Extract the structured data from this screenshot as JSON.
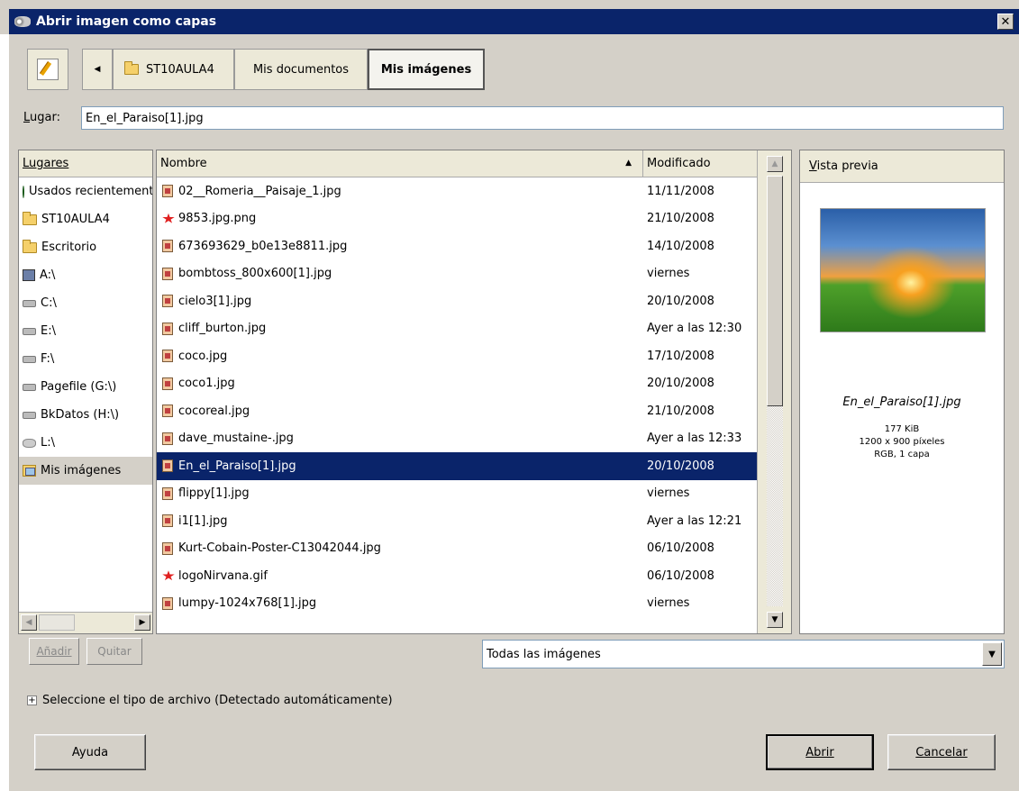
{
  "window": {
    "title": "Abrir imagen como capas",
    "close_glyph": "✕"
  },
  "pathbar": {
    "back_glyph": "◀",
    "crumbs": [
      "ST10AULA4",
      "Mis documentos",
      "Mis imágenes"
    ]
  },
  "location": {
    "label": "Lugar:",
    "value": "En_el_Paraiso[1].jpg"
  },
  "places": {
    "header": "Lugares",
    "items": [
      {
        "label": "Usados recientemente",
        "icon": "history-icon"
      },
      {
        "label": "ST10AULA4",
        "icon": "folder-icon"
      },
      {
        "label": "Escritorio",
        "icon": "folder-icon"
      },
      {
        "label": "A:\\",
        "icon": "floppy-icon"
      },
      {
        "label": "C:\\",
        "icon": "drive-icon"
      },
      {
        "label": "E:\\",
        "icon": "drive-icon"
      },
      {
        "label": "F:\\",
        "icon": "drive-icon"
      },
      {
        "label": "Pagefile (G:\\)",
        "icon": "drive-icon"
      },
      {
        "label": "BkDatos (H:\\)",
        "icon": "drive-icon"
      },
      {
        "label": "L:\\",
        "icon": "network-drive-icon"
      },
      {
        "label": "Mis imágenes",
        "icon": "pictures-folder-icon"
      }
    ]
  },
  "files": {
    "col_name": "Nombre",
    "col_modified": "Modificado",
    "sort_glyph": "▲",
    "rows": [
      {
        "name": "02__Romeria__Paisaje_1.jpg",
        "date": "11/11/2008"
      },
      {
        "name": "9853.jpg.png",
        "date": "21/10/2008"
      },
      {
        "name": "673693629_b0e13e8811.jpg",
        "date": "14/10/2008"
      },
      {
        "name": "bombtoss_800x600[1].jpg",
        "date": "viernes"
      },
      {
        "name": "cielo3[1].jpg",
        "date": "20/10/2008"
      },
      {
        "name": "cliff_burton.jpg",
        "date": "Ayer a las 12:30"
      },
      {
        "name": "coco.jpg",
        "date": "17/10/2008"
      },
      {
        "name": "coco1.jpg",
        "date": "20/10/2008"
      },
      {
        "name": "cocoreal.jpg",
        "date": "21/10/2008"
      },
      {
        "name": "dave_mustaine-.jpg",
        "date": "Ayer a las 12:33"
      },
      {
        "name": "En_el_Paraiso[1].jpg",
        "date": "20/10/2008"
      },
      {
        "name": "flippy[1].jpg",
        "date": "viernes"
      },
      {
        "name": "i1[1].jpg",
        "date": "Ayer a las 12:21"
      },
      {
        "name": "Kurt-Cobain-Poster-C13042044.jpg",
        "date": "06/10/2008"
      },
      {
        "name": "logoNirvana.gif",
        "date": "06/10/2008"
      },
      {
        "name": "lumpy-1024x768[1].jpg",
        "date": "viernes"
      }
    ]
  },
  "preview": {
    "header": "Vista previa",
    "filename": "En_el_Paraiso[1].jpg",
    "size": "177 KiB",
    "dimensions": "1200 x 900 píxeles",
    "mode": "RGB, 1 capa"
  },
  "buttons": {
    "add": "Añadir",
    "remove": "Quitar",
    "help": "Ayuda",
    "open": "Abrir",
    "cancel": "Cancelar"
  },
  "filter": {
    "selected": "Todas las imágenes",
    "drop_glyph": "▼"
  },
  "filetype": {
    "expander_glyph": "+",
    "label": "Seleccione el tipo de archivo (Detectado automáticamente)"
  },
  "scroll": {
    "up_glyph": "▲",
    "down_glyph": "▼",
    "left_glyph": "◀",
    "right_glyph": "▶"
  }
}
